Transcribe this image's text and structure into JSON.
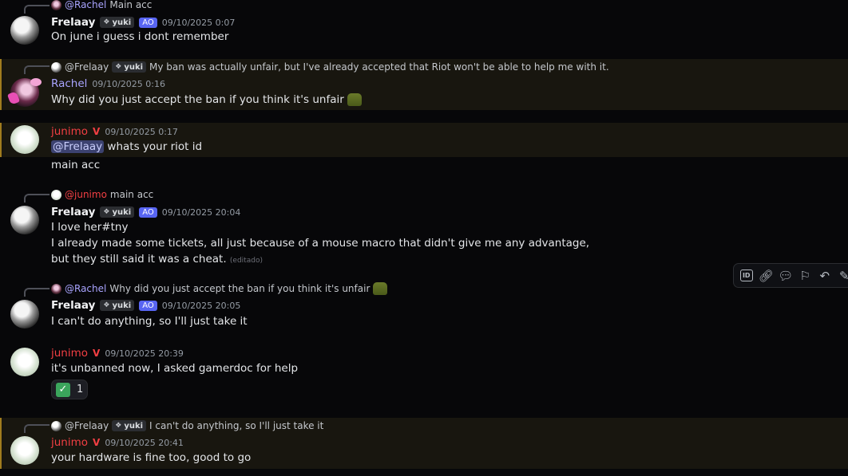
{
  "messages": [
    {
      "reply": {
        "author": "@Rachel",
        "text": "Main acc"
      },
      "author": "Frelaay",
      "tag": "yuki",
      "badge": "AO",
      "time": "09/10/2025 0:07",
      "lines": [
        "On june i guess i dont remember"
      ]
    },
    {
      "reply": {
        "author": "@Frelaay",
        "tag": "yuki",
        "text": "My ban was actually unfair, but I've already accepted that Riot won't be able to help me with it."
      },
      "author": "Rachel",
      "time": "09/10/2025 0:16",
      "lines": [
        "Why did you just accept the ban if you think it's unfair"
      ]
    },
    {
      "author": "junimo",
      "time": "09/10/2025 0:17",
      "mention": "@Frelaay",
      "line1_rest": " whats your riot id",
      "lines": [
        "main acc"
      ]
    },
    {
      "reply": {
        "author": "@junimo",
        "text": "main acc"
      },
      "author": "Frelaay",
      "tag": "yuki",
      "badge": "AO",
      "time": "09/10/2025 20:04",
      "lines": [
        "I love her#tny",
        "I already made some tickets, all just because of a mouse macro that didn't give me any advantage,",
        "but they still said it was a cheat."
      ],
      "edited": "(editado)"
    },
    {
      "reply": {
        "author": "@Rachel",
        "text": "Why did you just accept the ban if you think it's unfair"
      },
      "author": "Frelaay",
      "tag": "yuki",
      "badge": "AO",
      "time": "09/10/2025 20:05",
      "lines": [
        "I can't do anything, so I'll just take it"
      ]
    },
    {
      "author": "junimo",
      "time": "09/10/2025 20:39",
      "lines": [
        "it's unbanned now, I asked gamerdoc for help"
      ],
      "reaction": {
        "emoji": "check-mark",
        "count": "1"
      }
    },
    {
      "reply": {
        "author": "@Frelaay",
        "tag": "yuki",
        "text": "I can't do anything, so I'll just take it"
      },
      "author": "junimo",
      "time": "09/10/2025 20:41",
      "lines": [
        "your hardware is fine too, good to go"
      ]
    }
  ],
  "toolbar": {
    "id_label": "ID",
    "icons": [
      "id-icon",
      "link-icon",
      "thread-icon",
      "bookmark-icon",
      "reply-icon",
      "edit-icon"
    ]
  },
  "colors": {
    "highlight": "#18160f",
    "highlight_bar": "#a07c1e",
    "junimo": "#f23f43",
    "rachel": "#a9a4ff",
    "ao_badge": "#5865f2"
  }
}
